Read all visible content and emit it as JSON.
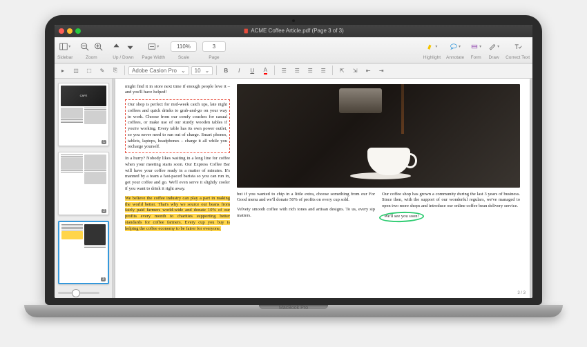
{
  "window": {
    "title": "ACME Coffee Article.pdf (Page 3 of 3)"
  },
  "toolbar": {
    "sidebar": "Sidebar",
    "zoom": "Zoom",
    "updown": "Up / Down",
    "pagewidth": "Page Width",
    "scale": "Scale",
    "scale_value": "110%",
    "page": "Page",
    "page_value": "3",
    "highlight": "Highlight",
    "annotate": "Annotate",
    "form": "Form",
    "draw": "Draw",
    "correct": "Correct Text"
  },
  "toolbar2": {
    "font": "Adobe Caslon Pro",
    "size": "10"
  },
  "thumbs": {
    "label1": "CAFE",
    "n1": "1",
    "n2": "2",
    "n3": "3"
  },
  "article": {
    "p1": "might find it in store next time if enough people love it – and you'll have helped!",
    "p2": "Our shop is perfect for mid-week catch ups, late night coffees and quick drinks to grab-and-go on your way to work. Choose from our comfy couches for casual coffees, or make use of our sturdy wooden tables if you're working. Every table has its own power outlet, so you never need to run out of charge. Smart phones, tablets, laptops, headphones – charge it all while you recharge yourself.",
    "p3": "In a hurry? Nobody likes waiting in a long line for coffee when your meeting starts soon. Our Express Coffee Bar will have your coffee ready in a matter of minutes. It's manned by a team a fast-paced barista so you can run in, get your coffee and go. We'll even serve it slightly cooler if you want to drink it right away.",
    "p4": "We believe the coffee industry can play a part in making the world better. That's why we source our beans from fairly paid farmers world-wide and donate 10% of our profits every month to charities supporting better standards for coffee farmers. Every cup you buy is helping the coffee economy to be fairer for everyone,",
    "b1": "but if you wanted to chip in a little extra, choose something from our For Good menu and we'll donate 50% of profits on every cup sold.",
    "b2": "Velvety smooth coffee with rich tones and artisan designs. To us, every sip matters.",
    "b3": "Our coffee shop has grown a community during the last 3 years of business. Since then, with the support of our wonderful regulars, we've managed to open two more shops and introduce our online coffee bean delivery service.",
    "b4": "We'll see you soon!"
  },
  "page_indicator": "3 / 3",
  "laptop": "MacBook Pro"
}
